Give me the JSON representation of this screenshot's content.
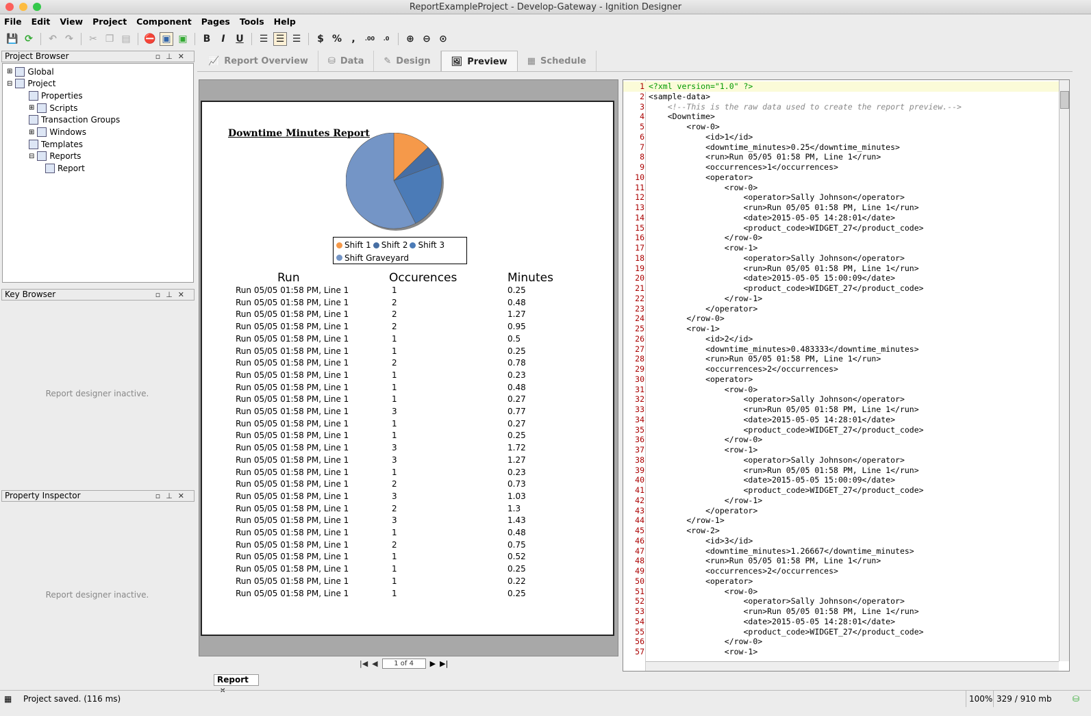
{
  "window": {
    "title": "ReportExampleProject - Develop-Gateway - Ignition Designer"
  },
  "menu": [
    "File",
    "Edit",
    "View",
    "Project",
    "Component",
    "Pages",
    "Tools",
    "Help"
  ],
  "panels": {
    "project_browser": "Project Browser",
    "key_browser": "Key Browser",
    "property_inspector": "Property Inspector",
    "inactive_text": "Report designer inactive."
  },
  "tree": [
    {
      "label": "Global",
      "level": 0,
      "icon": "globe-icon"
    },
    {
      "label": "Project",
      "level": 0,
      "icon": "project-icon"
    },
    {
      "label": "Properties",
      "level": 1,
      "icon": "properties-icon"
    },
    {
      "label": "Scripts",
      "level": 1,
      "icon": "scripts-icon"
    },
    {
      "label": "Transaction Groups",
      "level": 1,
      "icon": "transaction-groups-icon"
    },
    {
      "label": "Windows",
      "level": 1,
      "icon": "windows-icon"
    },
    {
      "label": "Templates",
      "level": 1,
      "icon": "templates-icon"
    },
    {
      "label": "Reports",
      "level": 1,
      "icon": "reports-icon"
    },
    {
      "label": "Report",
      "level": 2,
      "icon": "report-icon"
    }
  ],
  "tabs": [
    {
      "label": "Report Overview"
    },
    {
      "label": "Data"
    },
    {
      "label": "Design"
    },
    {
      "label": "Preview",
      "active": true
    },
    {
      "label": "Schedule"
    }
  ],
  "report": {
    "title": "Downtime Minutes Report",
    "headers": [
      "Run",
      "Occurences",
      "Minutes"
    ],
    "rows": [
      [
        "Run 05/05 01:58 PM, Line 1",
        "1",
        "0.25"
      ],
      [
        "Run 05/05 01:58 PM, Line 1",
        "2",
        "0.48"
      ],
      [
        "Run 05/05 01:58 PM, Line 1",
        "2",
        "1.27"
      ],
      [
        "Run 05/05 01:58 PM, Line 1",
        "2",
        "0.95"
      ],
      [
        "Run 05/05 01:58 PM, Line 1",
        "1",
        "0.5"
      ],
      [
        "Run 05/05 01:58 PM, Line 1",
        "1",
        "0.25"
      ],
      [
        "Run 05/05 01:58 PM, Line 1",
        "2",
        "0.78"
      ],
      [
        "Run 05/05 01:58 PM, Line 1",
        "1",
        "0.23"
      ],
      [
        "Run 05/05 01:58 PM, Line 1",
        "1",
        "0.48"
      ],
      [
        "Run 05/05 01:58 PM, Line 1",
        "1",
        "0.27"
      ],
      [
        "Run 05/05 01:58 PM, Line 1",
        "3",
        "0.77"
      ],
      [
        "Run 05/05 01:58 PM, Line 1",
        "1",
        "0.27"
      ],
      [
        "Run 05/05 01:58 PM, Line 1",
        "1",
        "0.25"
      ],
      [
        "Run 05/05 01:58 PM, Line 1",
        "3",
        "1.72"
      ],
      [
        "Run 05/05 01:58 PM, Line 1",
        "3",
        "1.27"
      ],
      [
        "Run 05/05 01:58 PM, Line 1",
        "1",
        "0.23"
      ],
      [
        "Run 05/05 01:58 PM, Line 1",
        "2",
        "0.73"
      ],
      [
        "Run 05/05 01:58 PM, Line 1",
        "3",
        "1.03"
      ],
      [
        "Run 05/05 01:58 PM, Line 1",
        "2",
        "1.3"
      ],
      [
        "Run 05/05 01:58 PM, Line 1",
        "3",
        "1.43"
      ],
      [
        "Run 05/05 01:58 PM, Line 1",
        "1",
        "0.48"
      ],
      [
        "Run 05/05 01:58 PM, Line 1",
        "2",
        "0.75"
      ],
      [
        "Run 05/05 01:58 PM, Line 1",
        "1",
        "0.52"
      ],
      [
        "Run 05/05 01:58 PM, Line 1",
        "1",
        "0.25"
      ],
      [
        "Run 05/05 01:58 PM, Line 1",
        "1",
        "0.22"
      ],
      [
        "Run 05/05 01:58 PM, Line 1",
        "1",
        "0.25"
      ]
    ]
  },
  "chart_data": {
    "type": "pie",
    "title": "",
    "categories": [
      "Shift 1",
      "Shift 2",
      "Shift 3",
      "Shift Graveyard"
    ],
    "values": [
      12.7,
      6.6,
      23.2,
      57.5
    ],
    "colors": [
      "#f5994a",
      "#466ea3",
      "#4b7bb7",
      "#7495c6"
    ],
    "legend": "bottom"
  },
  "pager": {
    "page": "1 of 4"
  },
  "xml_lines": [
    "<?xml version=\"1.0\" ?>",
    "<sample-data>",
    "    <!--This is the raw data used to create the report preview.-->",
    "    <Downtime>",
    "        <row-0>",
    "            <id>1</id>",
    "            <downtime_minutes>0.25</downtime_minutes>",
    "            <run>Run 05/05 01:58 PM, Line 1</run>",
    "            <occurrences>1</occurrences>",
    "            <operator>",
    "                <row-0>",
    "                    <operator>Sally Johnson</operator>",
    "                    <run>Run 05/05 01:58 PM, Line 1</run>",
    "                    <date>2015-05-05 14:28:01</date>",
    "                    <product_code>WIDGET_27</product_code>",
    "                </row-0>",
    "                <row-1>",
    "                    <operator>Sally Johnson</operator>",
    "                    <run>Run 05/05 01:58 PM, Line 1</run>",
    "                    <date>2015-05-05 15:00:09</date>",
    "                    <product_code>WIDGET_27</product_code>",
    "                </row-1>",
    "            </operator>",
    "        </row-0>",
    "        <row-1>",
    "            <id>2</id>",
    "            <downtime_minutes>0.483333</downtime_minutes>",
    "            <run>Run 05/05 01:58 PM, Line 1</run>",
    "            <occurrences>2</occurrences>",
    "            <operator>",
    "                <row-0>",
    "                    <operator>Sally Johnson</operator>",
    "                    <run>Run 05/05 01:58 PM, Line 1</run>",
    "                    <date>2015-05-05 14:28:01</date>",
    "                    <product_code>WIDGET_27</product_code>",
    "                </row-0>",
    "                <row-1>",
    "                    <operator>Sally Johnson</operator>",
    "                    <run>Run 05/05 01:58 PM, Line 1</run>",
    "                    <date>2015-05-05 15:00:09</date>",
    "                    <product_code>WIDGET_27</product_code>",
    "                </row-1>",
    "            </operator>",
    "        </row-1>",
    "        <row-2>",
    "            <id>3</id>",
    "            <downtime_minutes>1.26667</downtime_minutes>",
    "            <run>Run 05/05 01:58 PM, Line 1</run>",
    "            <occurrences>2</occurrences>",
    "            <operator>",
    "                <row-0>",
    "                    <operator>Sally Johnson</operator>",
    "                    <run>Run 05/05 01:58 PM, Line 1</run>",
    "                    <date>2015-05-05 14:28:01</date>",
    "                    <product_code>WIDGET_27</product_code>",
    "                </row-0>",
    "                <row-1>"
  ],
  "bottom_tab": {
    "label": "Report",
    "close": "✕"
  },
  "status": {
    "message": "Project saved. (116 ms)",
    "zoom": "100%",
    "memory": "329 / 910 mb"
  }
}
